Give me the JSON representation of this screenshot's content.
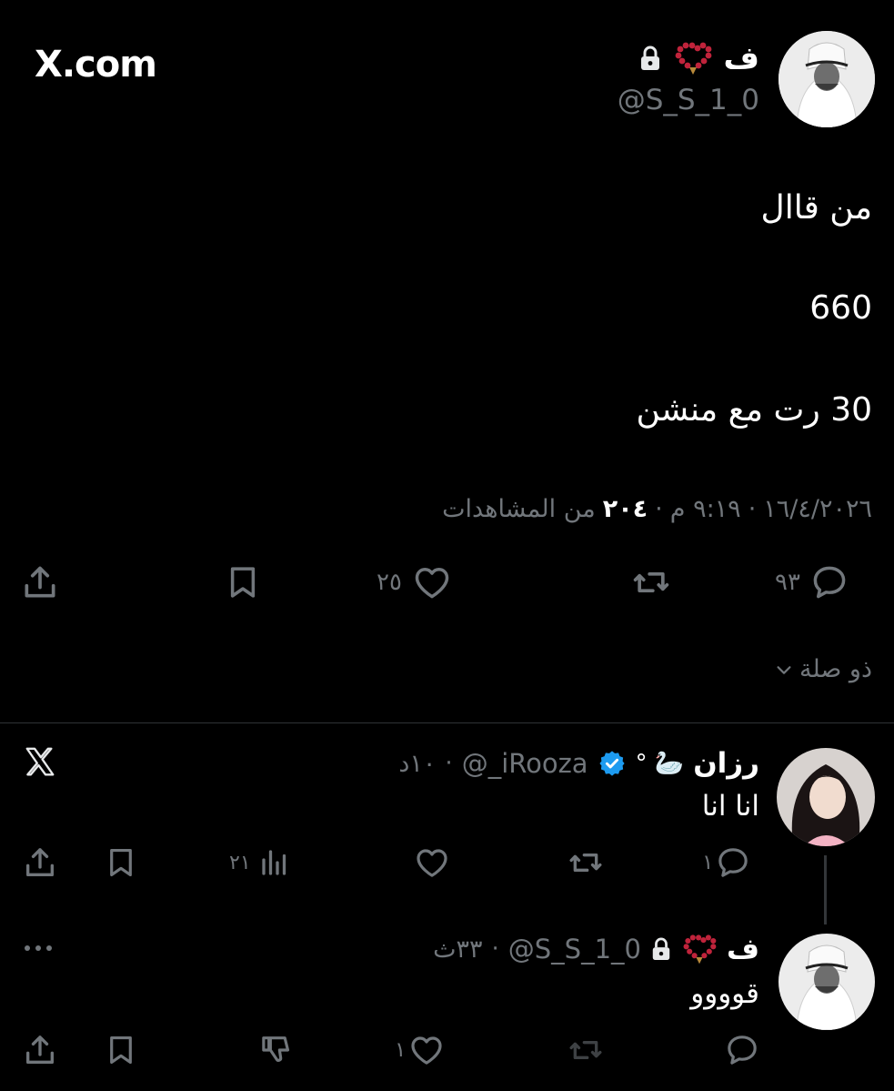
{
  "site_label": "X.com",
  "main_tweet": {
    "author": {
      "name": "ف",
      "handle": "@S_S_1_0",
      "avatar_icon": "avatar-man-ghutra-icon"
    },
    "lines": [
      "من قاال",
      "660",
      "30 رت مع منشن"
    ],
    "meta": {
      "date": "١٦/٤/٢٠٢٦",
      "time": "٩:١٩ م",
      "views_count": "٢٠٤",
      "views_label": "من المشاهدات",
      "sep": "·"
    },
    "actions": {
      "reply_count": "٩٣",
      "retweet_count": "",
      "like_count": "٢٥"
    }
  },
  "related_label": "ذو صلة",
  "reply1": {
    "name": "رزان",
    "name_decor": "🦢 °",
    "handle": "@_iRooza",
    "time": "١٠د",
    "sep": "·",
    "text": "انا انا",
    "actions": {
      "reply_count": "١",
      "retweet_count": "",
      "like_count": "",
      "views_count": "٢١"
    }
  },
  "reply2": {
    "name": "ف",
    "handle": "@S_S_1_0",
    "time": "٣٣ث",
    "sep": "·",
    "text": "قوووو",
    "actions": {
      "reply_count": "",
      "retweet_count": "",
      "like_count": "١"
    }
  },
  "colors": {
    "background": "#000000",
    "text": "#e7e9ea",
    "muted": "#71767b",
    "divider": "#2f3336",
    "verified": "#1d9bf0",
    "bead_red": "#c0233b"
  }
}
